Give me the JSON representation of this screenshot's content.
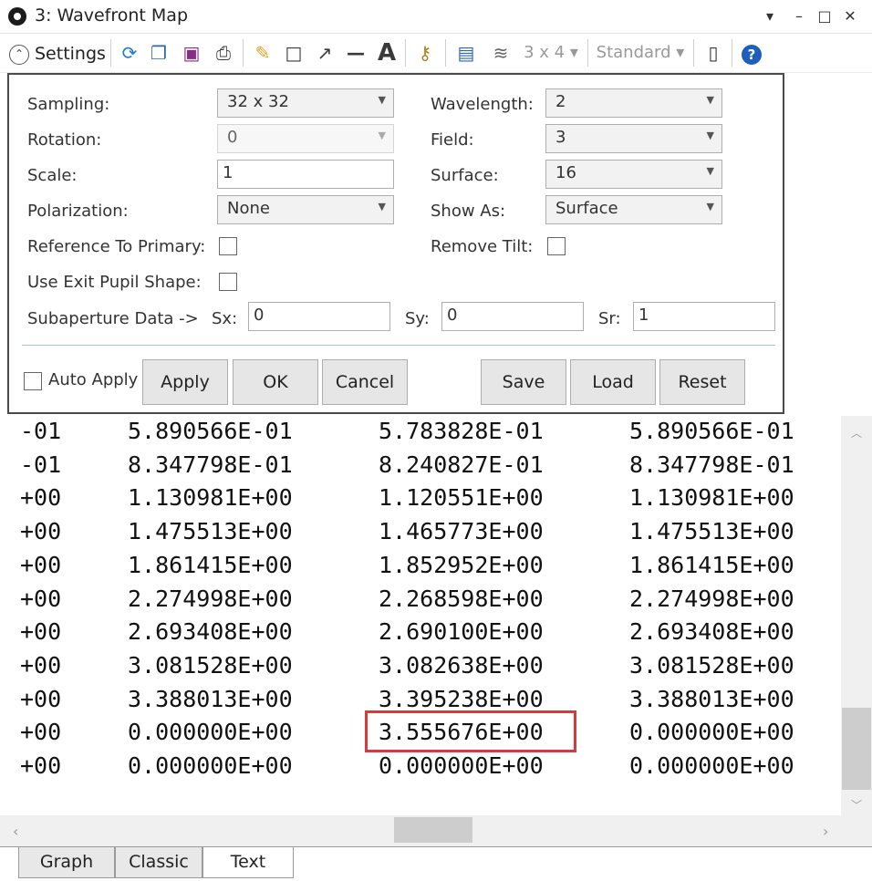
{
  "window": {
    "title": "3: Wavefront Map",
    "buttons": [
      "▾",
      "–",
      "□",
      "✕"
    ]
  },
  "toolbar": {
    "settings_label": "Settings",
    "layout_label": "3 x 4",
    "mode_label": "Standard",
    "icons": [
      "refresh-icon",
      "copy-icon",
      "save-icon",
      "print-icon",
      "pencil-icon",
      "rectangle-icon",
      "arrow-icon",
      "line-icon",
      "text-icon",
      "lock-icon",
      "window-icon",
      "layers-icon",
      "layout-icon",
      "standard-icon",
      "phone-icon",
      "help-icon"
    ]
  },
  "settings": {
    "sampling": {
      "label": "Sampling:",
      "value": "32 x 32"
    },
    "rotation": {
      "label": "Rotation:",
      "value": "0"
    },
    "scale": {
      "label": "Scale:",
      "value": "1"
    },
    "polarization": {
      "label": "Polarization:",
      "value": "None"
    },
    "reference_primary": {
      "label": "Reference To Primary:",
      "checked": false
    },
    "exit_pupil": {
      "label": "Use Exit Pupil Shape:",
      "checked": false
    },
    "wavelength": {
      "label": "Wavelength:",
      "value": "2"
    },
    "field": {
      "label": "Field:",
      "value": "3"
    },
    "surface": {
      "label": "Surface:",
      "value": "16"
    },
    "show_as": {
      "label": "Show As:",
      "value": "Surface"
    },
    "remove_tilt": {
      "label": "Remove Tilt:",
      "checked": false
    },
    "subaperture": {
      "label": "Subaperture Data ->",
      "sx_label": "Sx:",
      "sx": "0",
      "sy_label": "Sy:",
      "sy": "0",
      "sr_label": "Sr:",
      "sr": "1"
    },
    "auto_apply": {
      "label": "Auto Apply",
      "checked": false
    },
    "buttons": {
      "apply": "Apply",
      "ok": "OK",
      "cancel": "Cancel",
      "save": "Save",
      "load": "Load",
      "reset": "Reset"
    }
  },
  "text_output": {
    "rows": [
      [
        "-01",
        "5.890566E-01",
        "5.783828E-01",
        "5.890566E-01"
      ],
      [
        "-01",
        "8.347798E-01",
        "8.240827E-01",
        "8.347798E-01"
      ],
      [
        "+00",
        "1.130981E+00",
        "1.120551E+00",
        "1.130981E+00"
      ],
      [
        "+00",
        "1.475513E+00",
        "1.465773E+00",
        "1.475513E+00"
      ],
      [
        "+00",
        "1.861415E+00",
        "1.852952E+00",
        "1.861415E+00"
      ],
      [
        "+00",
        "2.274998E+00",
        "2.268598E+00",
        "2.274998E+00"
      ],
      [
        "+00",
        "2.693408E+00",
        "2.690100E+00",
        "2.693408E+00"
      ],
      [
        "+00",
        "3.081528E+00",
        "3.082638E+00",
        "3.081528E+00"
      ],
      [
        "+00",
        "3.388013E+00",
        "3.395238E+00",
        "3.388013E+00"
      ],
      [
        "+00",
        "0.000000E+00",
        "3.555676E+00",
        "0.000000E+00"
      ],
      [
        "+00",
        "0.000000E+00",
        "0.000000E+00",
        "0.000000E+00"
      ]
    ],
    "highlight_color": "#d63a3a"
  },
  "tabs": [
    {
      "label": "Graph",
      "active": false
    },
    {
      "label": "Classic",
      "active": false
    },
    {
      "label": "Text",
      "active": true
    }
  ]
}
